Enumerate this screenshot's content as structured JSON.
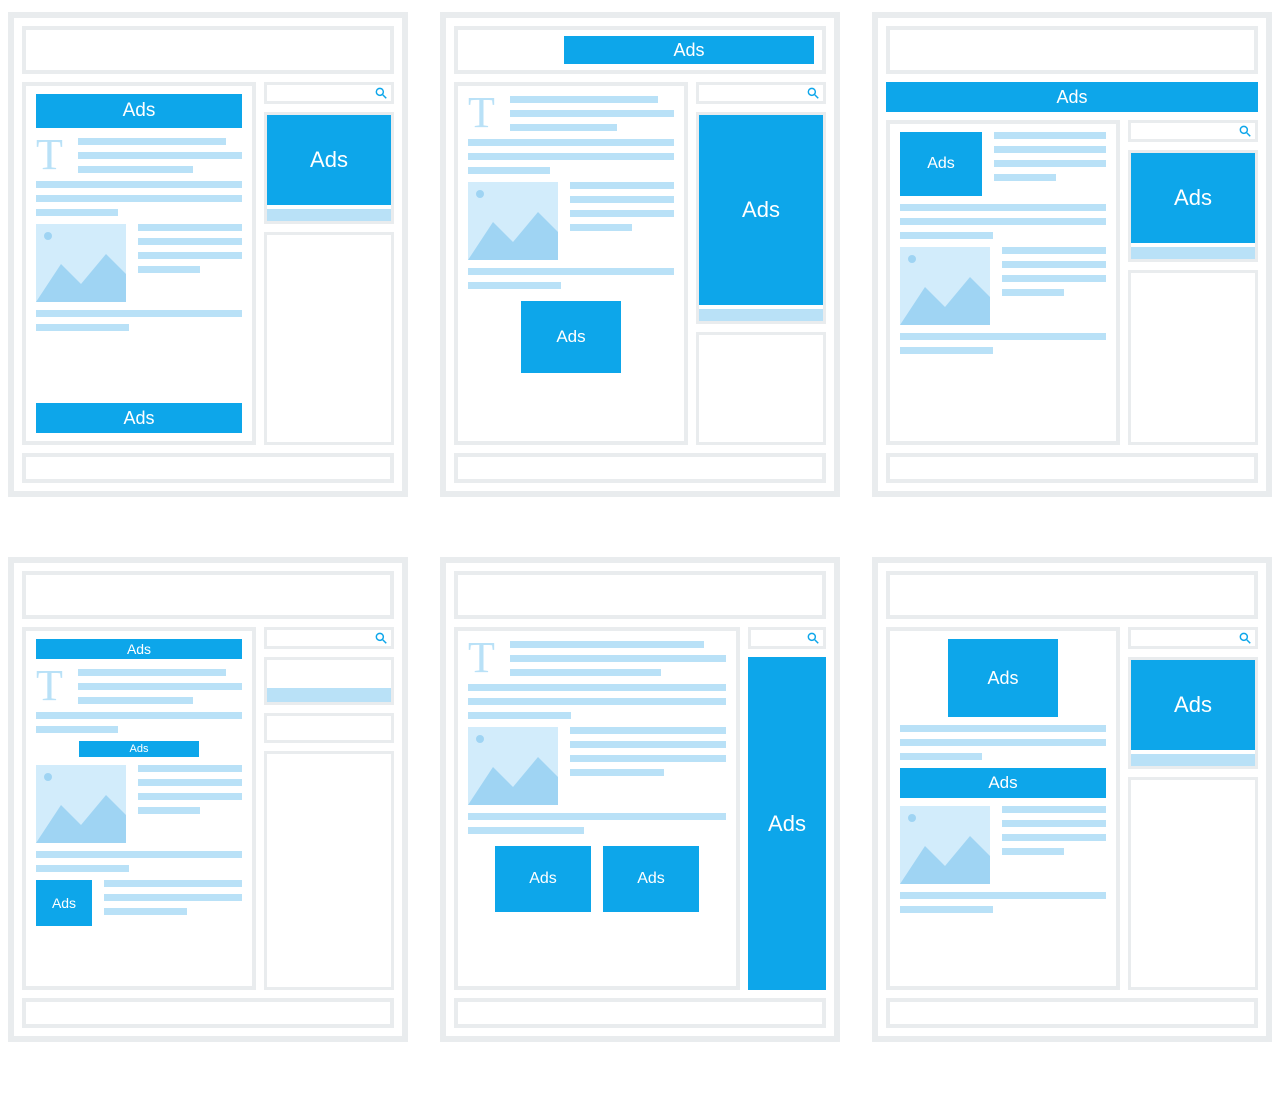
{
  "ads_label": "Ads",
  "dropcap_letter": "T",
  "layouts": [
    {
      "id": 1
    },
    {
      "id": 2
    },
    {
      "id": 3
    },
    {
      "id": 4
    },
    {
      "id": 5
    },
    {
      "id": 6
    }
  ]
}
